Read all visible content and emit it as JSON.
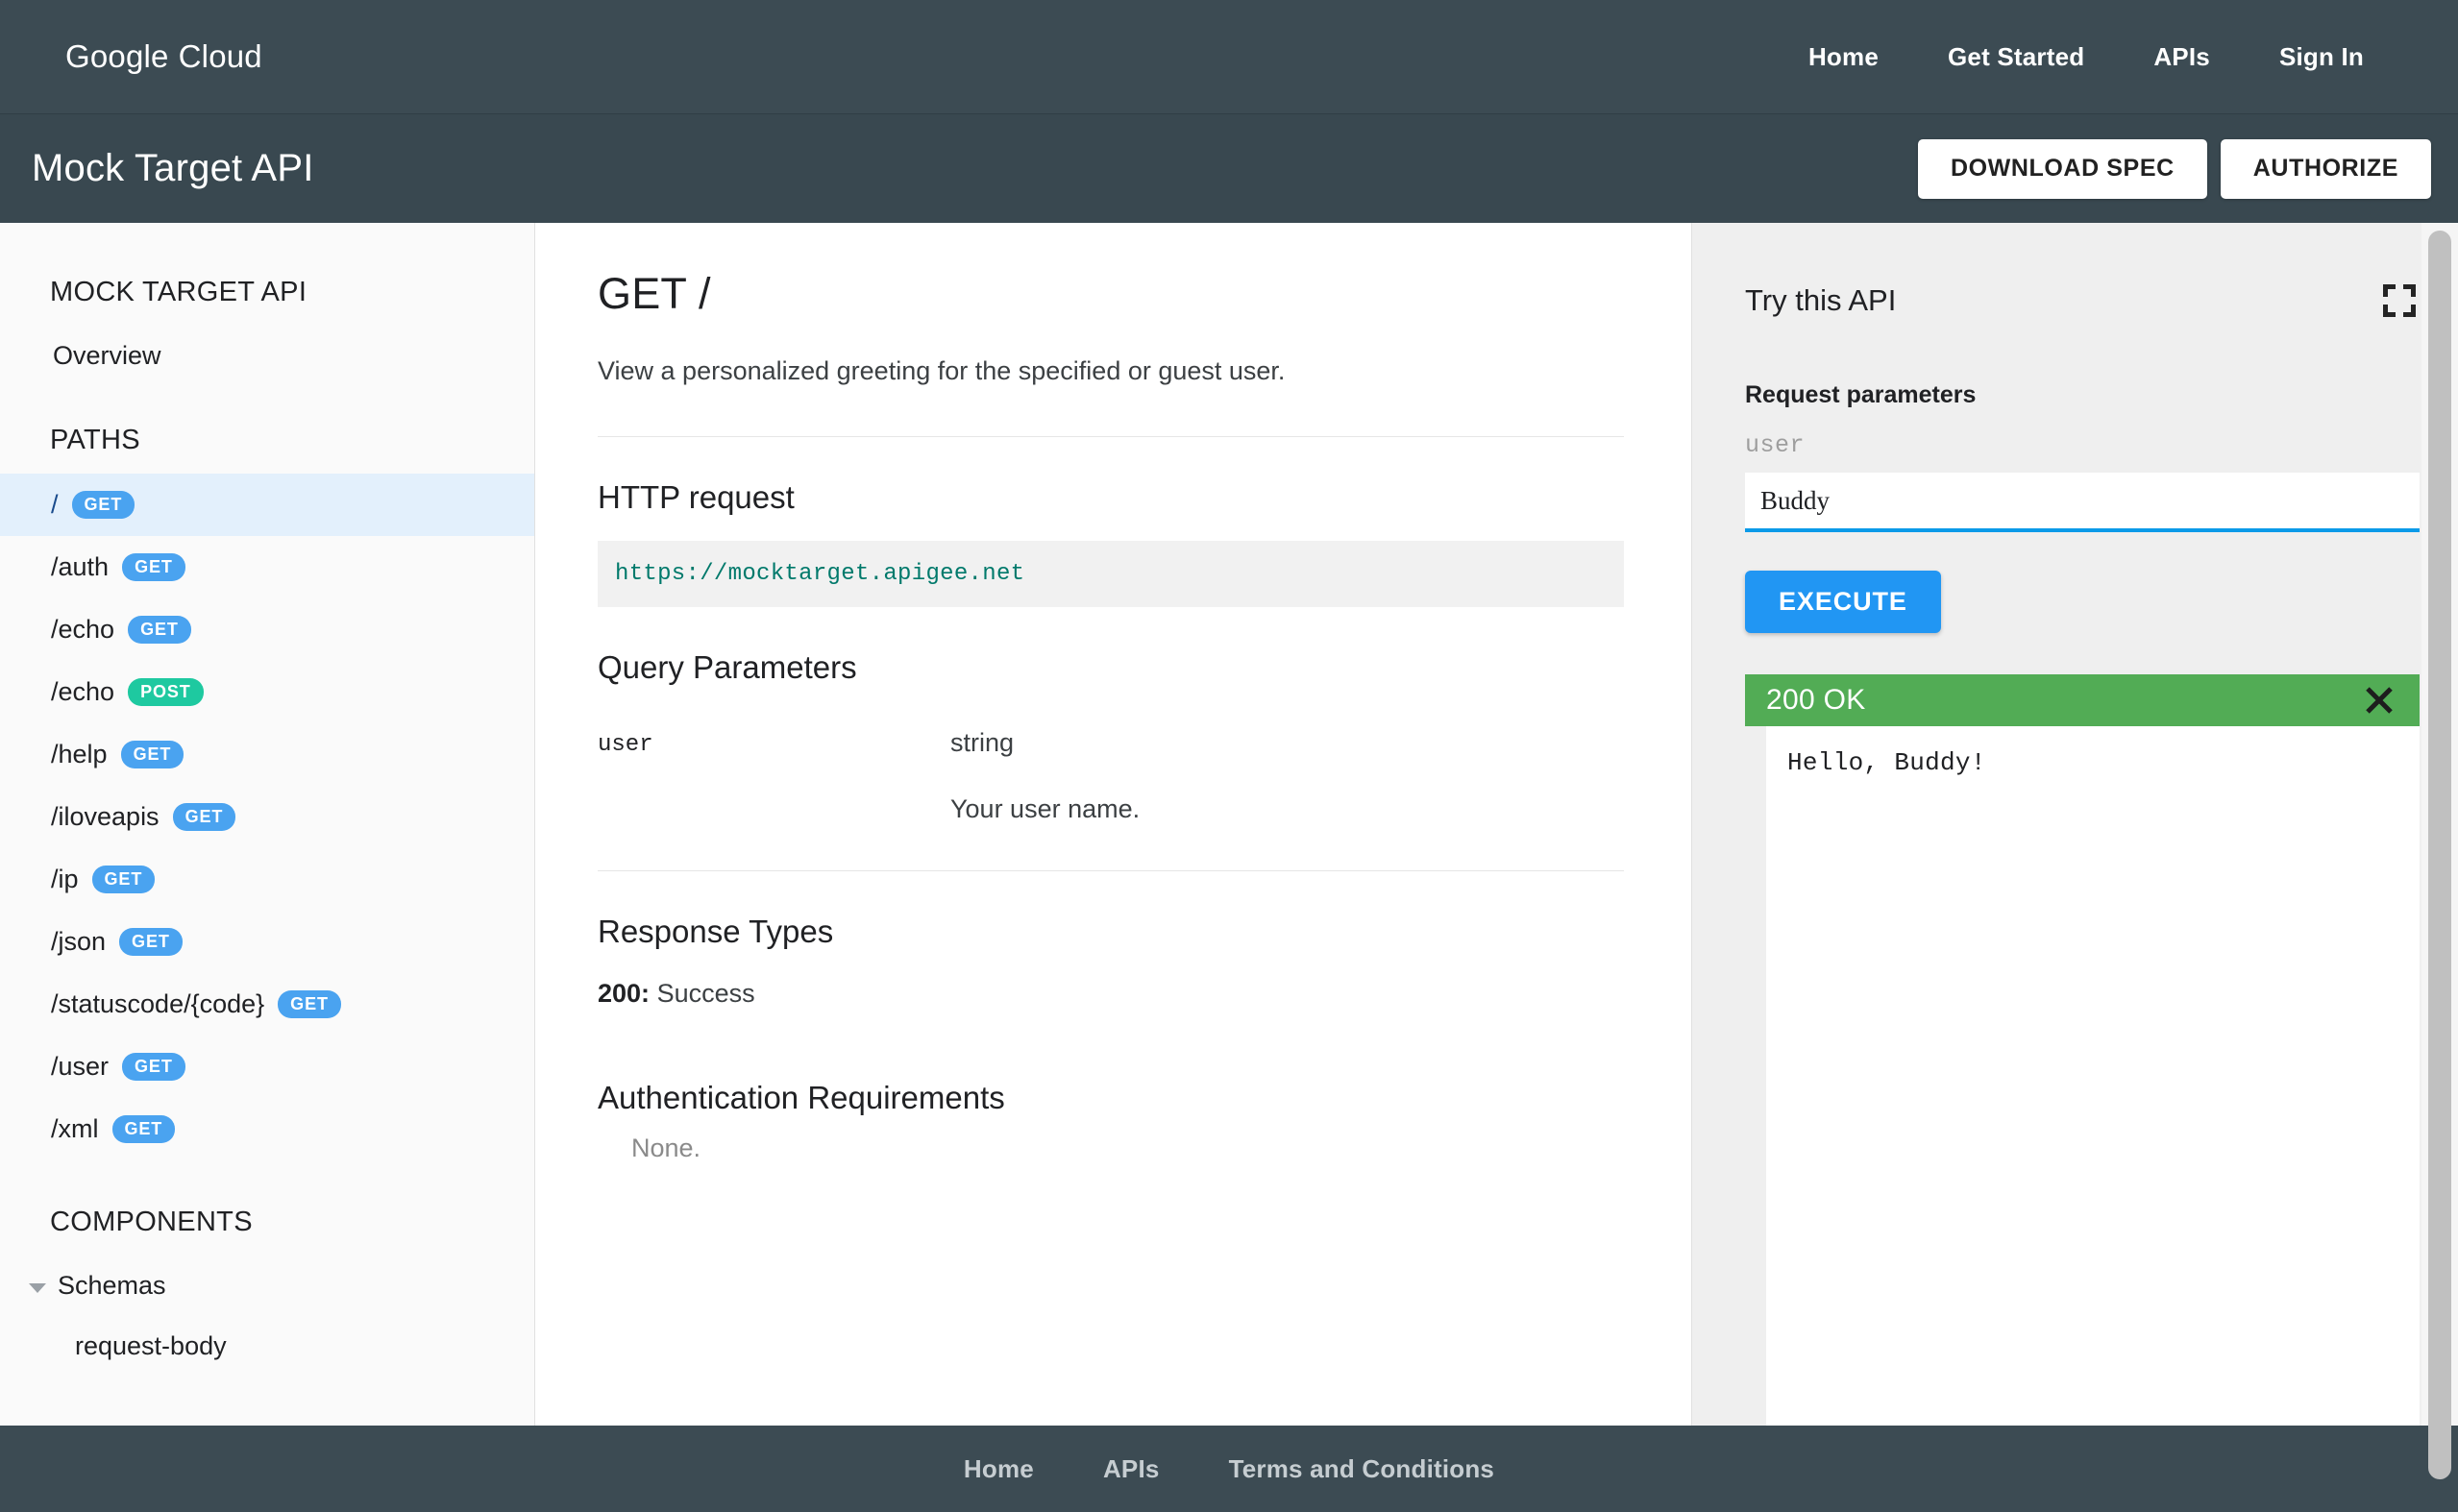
{
  "topnav": {
    "brand_google": "Google",
    "brand_cloud": "Cloud",
    "links": [
      {
        "label": "Home"
      },
      {
        "label": "Get Started"
      },
      {
        "label": "APIs"
      },
      {
        "label": "Sign In"
      }
    ]
  },
  "titlebar": {
    "title": "Mock Target API",
    "download_spec_label": "DOWNLOAD SPEC",
    "authorize_label": "AUTHORIZE"
  },
  "sidebar": {
    "api_heading": "MOCK TARGET API",
    "overview_label": "Overview",
    "paths_heading": "PATHS",
    "paths": [
      {
        "path": "/",
        "verb": "GET",
        "selected": true
      },
      {
        "path": "/auth",
        "verb": "GET",
        "selected": false
      },
      {
        "path": "/echo",
        "verb": "GET",
        "selected": false
      },
      {
        "path": "/echo",
        "verb": "POST",
        "selected": false
      },
      {
        "path": "/help",
        "verb": "GET",
        "selected": false
      },
      {
        "path": "/iloveapis",
        "verb": "GET",
        "selected": false
      },
      {
        "path": "/ip",
        "verb": "GET",
        "selected": false
      },
      {
        "path": "/json",
        "verb": "GET",
        "selected": false
      },
      {
        "path": "/statuscode/{code}",
        "verb": "GET",
        "selected": false
      },
      {
        "path": "/user",
        "verb": "GET",
        "selected": false
      },
      {
        "path": "/xml",
        "verb": "GET",
        "selected": false
      }
    ],
    "components_heading": "COMPONENTS",
    "schemas_label": "Schemas",
    "schema_items": [
      {
        "label": "request-body"
      }
    ]
  },
  "main": {
    "operation_title": "GET /",
    "description": "View a personalized greeting for the specified or guest user.",
    "http_request_heading": "HTTP request",
    "request_url": "https://mocktarget.apigee.net",
    "query_parameters_heading": "Query Parameters",
    "parameters": [
      {
        "name": "user",
        "type": "string",
        "description": "Your user name."
      }
    ],
    "response_types_heading": "Response Types",
    "response_code": "200:",
    "response_text": "Success",
    "auth_heading": "Authentication Requirements",
    "auth_value": "None."
  },
  "trypanel": {
    "title": "Try this API",
    "expand_icon": "fullscreen-icon",
    "request_parameters_label": "Request parameters",
    "user_field_label": "user",
    "user_field_value": "Buddy",
    "user_field_placeholder": "",
    "execute_label": "EXECUTE",
    "response_status": "200 OK",
    "close_icon": "close-icon",
    "response_body": "Hello, Buddy!"
  },
  "footer": {
    "links": [
      {
        "label": "Home"
      },
      {
        "label": "APIs"
      },
      {
        "label": "Terms and Conditions"
      }
    ]
  },
  "colors": {
    "header_bg": "#3c4b53",
    "titlebar_bg": "#394850",
    "accent_blue": "#2196f3",
    "verb_get": "#4aa3f0",
    "verb_post": "#1ec9a0",
    "status_success": "#52ac55",
    "selected_row": "#e3f0fc",
    "url_teal": "#00796b"
  }
}
